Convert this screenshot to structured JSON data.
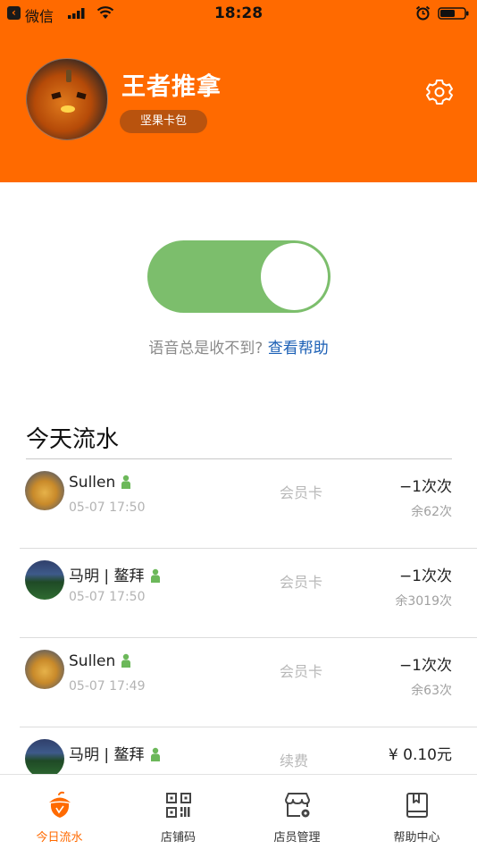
{
  "status_bar": {
    "back_app": "微信",
    "time": "18:28",
    "icons": [
      "signal-icon",
      "wifi-icon",
      "alarm-icon",
      "battery-icon"
    ]
  },
  "header": {
    "shop_name": "王者推拿",
    "wallet_label": "坚果卡包",
    "settings_icon": "gear-icon"
  },
  "voice_toggle": {
    "on": true,
    "on_color": "#7cbe6c"
  },
  "help": {
    "question": "语音总是收不到?",
    "link": "查看帮助"
  },
  "today_flow": {
    "title": "今天流水",
    "rows": [
      {
        "name": "Sullen",
        "time": "05-07 17:50",
        "type": "会员卡",
        "amount": "−1次次",
        "balance": "余62次"
      },
      {
        "name": "马明 | 鳌拜",
        "time": "05-07 17:50",
        "type": "会员卡",
        "amount": "−1次次",
        "balance": "余3019次"
      },
      {
        "name": "Sullen",
        "time": "05-07 17:49",
        "type": "会员卡",
        "amount": "−1次次",
        "balance": "余63次"
      },
      {
        "name": "马明 | 鳌拜",
        "time": "",
        "type": "续费",
        "amount": "¥ 0.10元",
        "balance": ""
      }
    ]
  },
  "tabbar": {
    "tabs": [
      {
        "label": "今日流水",
        "icon": "acorn-icon",
        "active": true
      },
      {
        "label": "店铺码",
        "icon": "qr-code-icon",
        "active": false
      },
      {
        "label": "店员管理",
        "icon": "store-settings-icon",
        "active": false
      },
      {
        "label": "帮助中心",
        "icon": "help-book-icon",
        "active": false
      }
    ]
  },
  "colors": {
    "brand": "#ff6a00",
    "link": "#1b5fb5",
    "member_icon": "#6cb85a"
  }
}
